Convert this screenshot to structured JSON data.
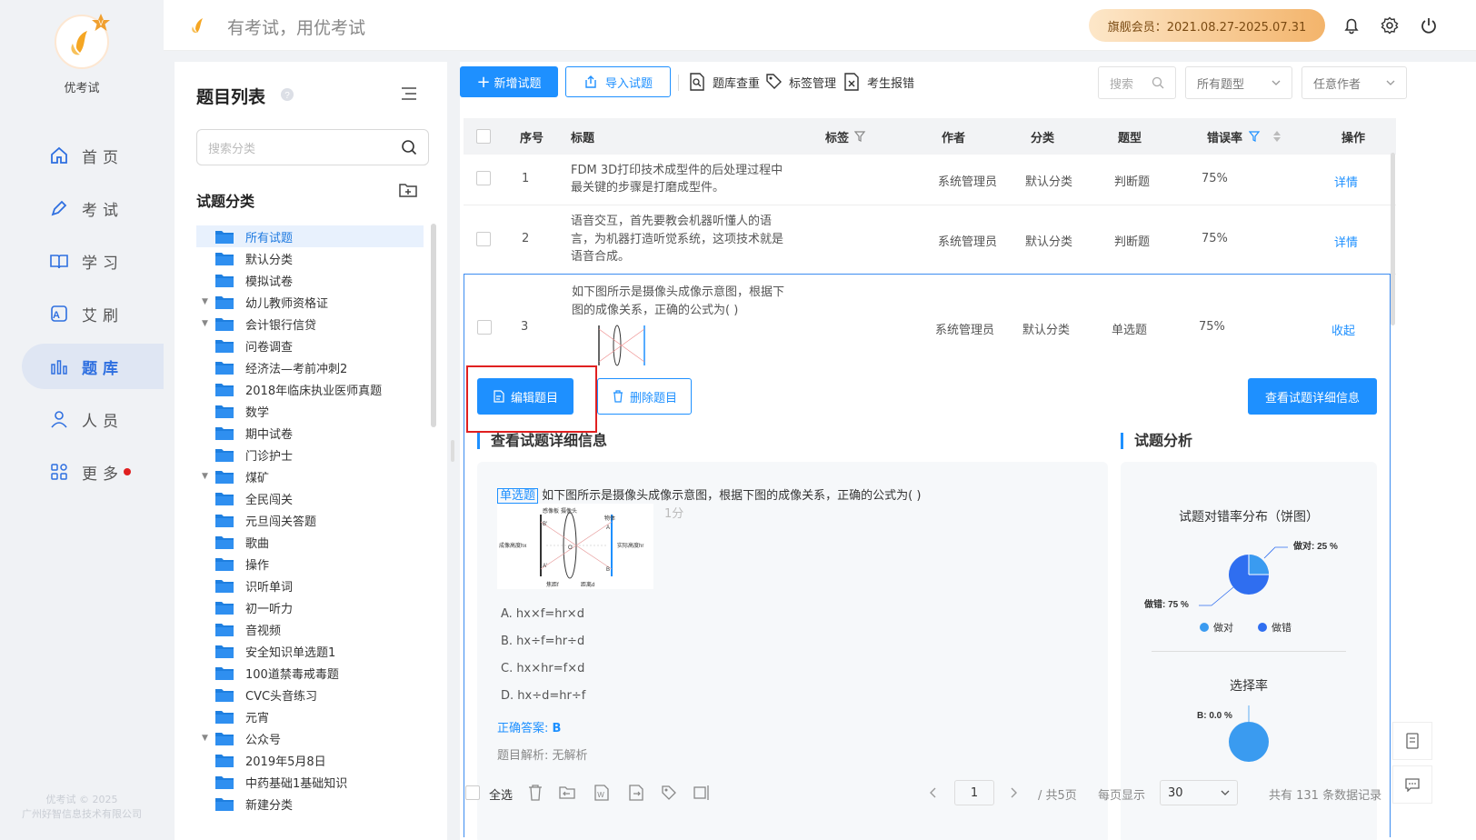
{
  "app": {
    "name": "优考试",
    "slogan": "有考试，用优考试",
    "member": "旗舰会员：2021.08.27-2025.07.31",
    "copyright_line1": "优考试 © 2025",
    "copyright_line2": "广州好智信息技术有限公司"
  },
  "nav": [
    {
      "label": "首页",
      "icon": "home-icon"
    },
    {
      "label": "考试",
      "icon": "pencil-icon"
    },
    {
      "label": "学习",
      "icon": "book-icon"
    },
    {
      "label": "艾刷",
      "icon": "brush-icon"
    },
    {
      "label": "题库",
      "icon": "bar-chart-icon",
      "active": true
    },
    {
      "label": "人员",
      "icon": "user-icon"
    },
    {
      "label": "更多",
      "icon": "apps-icon"
    }
  ],
  "category_panel": {
    "title": "题目列表",
    "search_placeholder": "搜索分类",
    "subtitle": "试题分类",
    "items": [
      {
        "label": "所有试题",
        "selected": true
      },
      {
        "label": "默认分类"
      },
      {
        "label": "模拟试卷"
      },
      {
        "label": "幼儿教师资格证",
        "expandable": true
      },
      {
        "label": "会计银行信贷",
        "expandable": true
      },
      {
        "label": "问卷调查"
      },
      {
        "label": "经济法—考前冲刺2"
      },
      {
        "label": "2018年临床执业医师真题"
      },
      {
        "label": "数学"
      },
      {
        "label": "期中试卷"
      },
      {
        "label": "门诊护士"
      },
      {
        "label": "煤矿",
        "expandable": true
      },
      {
        "label": "全民闯关"
      },
      {
        "label": "元旦闯关答题"
      },
      {
        "label": "歌曲"
      },
      {
        "label": "操作"
      },
      {
        "label": "识听单词"
      },
      {
        "label": "初一听力"
      },
      {
        "label": "音视频"
      },
      {
        "label": "安全知识单选题1"
      },
      {
        "label": "100道禁毒戒毒题"
      },
      {
        "label": "CVC头音练习"
      },
      {
        "label": "元宵"
      },
      {
        "label": "公众号",
        "expandable": true
      },
      {
        "label": "2019年5月8日"
      },
      {
        "label": "中药基础1基础知识"
      },
      {
        "label": "新建分类"
      }
    ]
  },
  "toolbar": {
    "add": "新增试题",
    "import": "导入试题",
    "dedupe": "题库查重",
    "tags": "标签管理",
    "errors": "考生报错",
    "search_placeholder": "搜索",
    "type_filter": "所有题型",
    "author_filter": "任意作者"
  },
  "table": {
    "headers": {
      "index": "序号",
      "title": "标题",
      "tags": "标签",
      "author": "作者",
      "category": "分类",
      "type": "题型",
      "error_rate": "错误率",
      "action": "操作"
    },
    "rows": [
      {
        "index": "1",
        "title_lines": [
          "FDM 3D打印技术成型件的后处理过程中",
          "最关键的步骤是打磨成型件。"
        ],
        "author": "系统管理员",
        "category": "默认分类",
        "type": "判断题",
        "error_rate": "75%",
        "action": "详情"
      },
      {
        "index": "2",
        "title_lines": [
          "语音交互，首先要教会机器听懂人的语",
          "言，为机器打造听觉系统，这项技术就是",
          "语音合成。"
        ],
        "author": "系统管理员",
        "category": "默认分类",
        "type": "判断题",
        "error_rate": "75%",
        "action": "详情"
      },
      {
        "index": "3",
        "title_lines": [
          "如下图所示是摄像头成像示意图，根据下",
          "图的成像关系，正确的公式为( )"
        ],
        "author": "系统管理员",
        "category": "默认分类",
        "type": "单选题",
        "error_rate": "75%",
        "action": "收起"
      }
    ]
  },
  "detail": {
    "edit": "编辑题目",
    "delete": "删除题目",
    "view_detail": "查看试题详细信息",
    "section_title": "查看试题详细信息",
    "type_tag": "单选题",
    "question": "如下图所示是摄像头成像示意图，根据下图的成像关系，正确的公式为( )",
    "score": "1分",
    "diagram_labels": {
      "sensor": "感像板",
      "lens": "摄像头",
      "object": "物体",
      "img_h": "成像高度hx",
      "real_h": "实际高度hr",
      "focal": "焦距f",
      "dist": "距离d",
      "b1": "B'",
      "a1": "A'",
      "o": "O",
      "a": "A",
      "b": "B"
    },
    "options": [
      "A. hx×f=hr×d",
      "B. hx÷f=hr÷d",
      "C. hx×hr=f×d",
      "D. hx÷d=hr÷f"
    ],
    "answer_label": "正确答案:",
    "answer": "B",
    "analysis_label": "题目解析:",
    "analysis": "无解析"
  },
  "analysis": {
    "title": "试题分析",
    "pie_title": "试题对错率分布（饼图）",
    "correct_label": "做对: 25 %",
    "wrong_label": "做错: 75 %",
    "legend_correct": "做对",
    "legend_wrong": "做错",
    "select_title": "选择率",
    "select_label": "B: 0.0 %",
    "colors": {
      "correct": "#3a9bf0",
      "wrong": "#2f6ef0"
    }
  },
  "chart_data": [
    {
      "type": "pie",
      "title": "试题对错率分布（饼图）",
      "categories": [
        "做对",
        "做错"
      ],
      "values": [
        25,
        75
      ]
    },
    {
      "type": "pie",
      "title": "选择率",
      "categories": [
        "B"
      ],
      "values": [
        0.0
      ]
    }
  ],
  "footer": {
    "select_all": "全选",
    "page": "1",
    "total_pages": "/ 共5页",
    "per_page_label": "每页显示",
    "per_page": "30",
    "total": "共有 131 条数据记录"
  }
}
